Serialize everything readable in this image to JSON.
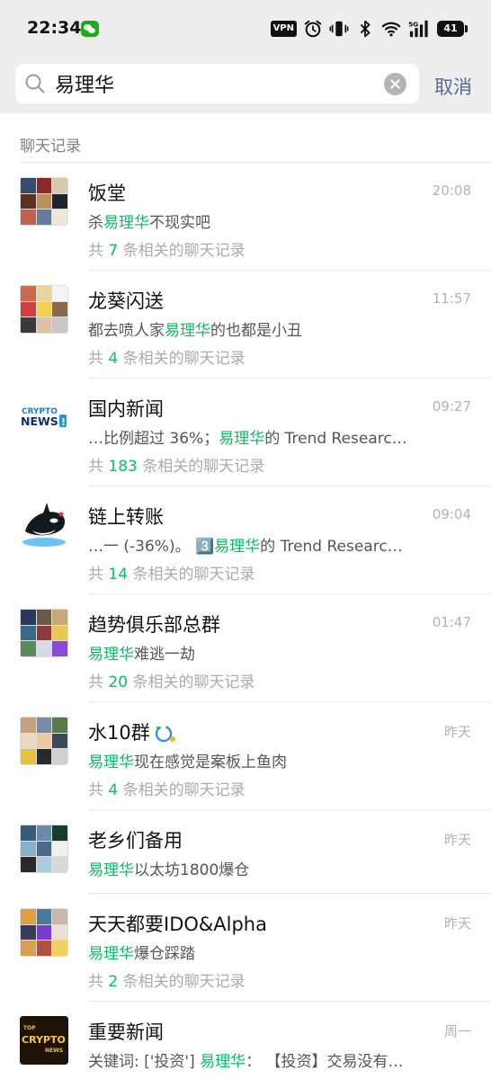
{
  "status_bar": {
    "time": "22:34",
    "vpn": "VPN",
    "network": "5G",
    "battery": "41",
    "icons": [
      "wechat-icon",
      "alarm-icon",
      "vibrate-icon",
      "bluetooth-icon",
      "wifi-icon",
      "signal-icon",
      "battery-icon"
    ]
  },
  "search": {
    "query": "易理华",
    "cancel_label": "取消"
  },
  "section": {
    "title": "聊天记录"
  },
  "colors": {
    "highlight": "#07c160",
    "cancel": "#576b95",
    "header_bg": "#ededed"
  },
  "results": [
    {
      "name": "饭堂",
      "time": "20:08",
      "snippet_before": "杀",
      "snippet_highlight": "易理华",
      "snippet_after": "不现实吧",
      "count_prefix": "共 ",
      "count": "7",
      "count_suffix": " 条相关的聊天记录",
      "avatar": "group-grid"
    },
    {
      "name": "龙葵闪送",
      "time": "11:57",
      "snippet_before": "都去喷人家",
      "snippet_highlight": "易理华",
      "snippet_after": "的也都是小丑",
      "count_prefix": "共 ",
      "count": "4",
      "count_suffix": " 条相关的聊天记录",
      "avatar": "group-grid"
    },
    {
      "name": "国内新闻",
      "time": "09:27",
      "snippet_before": "…比例超过 36%；",
      "snippet_highlight": "易理华",
      "snippet_after": "的 Trend Researc…",
      "count_prefix": "共 ",
      "count": "183",
      "count_suffix": " 条相关的聊天记录",
      "avatar": "crypto-news-logo",
      "avatar_text": "CRYPTO NEWS"
    },
    {
      "name": "链上转账",
      "time": "09:04",
      "snippet_before": "…一 (-36%)。 3️⃣",
      "snippet_highlight": "易理华",
      "snippet_after": "的 Trend Researc…",
      "count_prefix": "共 ",
      "count": "14",
      "count_suffix": " 条相关的聊天记录",
      "avatar": "orca-icon"
    },
    {
      "name": "趋势俱乐部总群",
      "time": "01:47",
      "snippet_before": "",
      "snippet_highlight": "易理华",
      "snippet_after": "难逃一劫",
      "count_prefix": "共 ",
      "count": "20",
      "count_suffix": " 条相关的聊天记录",
      "avatar": "group-grid"
    },
    {
      "name": "水10群",
      "time": "昨天",
      "snippet_before": "",
      "snippet_highlight": "易理华",
      "snippet_after": "现在感觉是案板上鱼肉",
      "count_prefix": "共 ",
      "count": "4",
      "count_suffix": " 条相关的聊天记录",
      "avatar": "group-grid",
      "badge": "enterprise-chat-icon"
    },
    {
      "name": "老乡们备用",
      "time": "昨天",
      "snippet_before": "",
      "snippet_highlight": "易理华",
      "snippet_after": "以太坊1800爆仓",
      "avatar": "group-grid"
    },
    {
      "name": "天天都要IDO&Alpha",
      "time": "昨天",
      "snippet_before": "",
      "snippet_highlight": "易理华",
      "snippet_after": "爆仓踩踏",
      "count_prefix": "共 ",
      "count": "2",
      "count_suffix": " 条相关的聊天记录",
      "avatar": "group-grid"
    },
    {
      "name": "重要新闻",
      "time": "周一",
      "snippet_before": "关键词: ['投资']  ",
      "snippet_highlight": "易理华",
      "snippet_after": "： 【投资】交易没有…",
      "avatar": "top-crypto-news-logo",
      "avatar_text": "TOP CRYPTO NEWS"
    }
  ]
}
